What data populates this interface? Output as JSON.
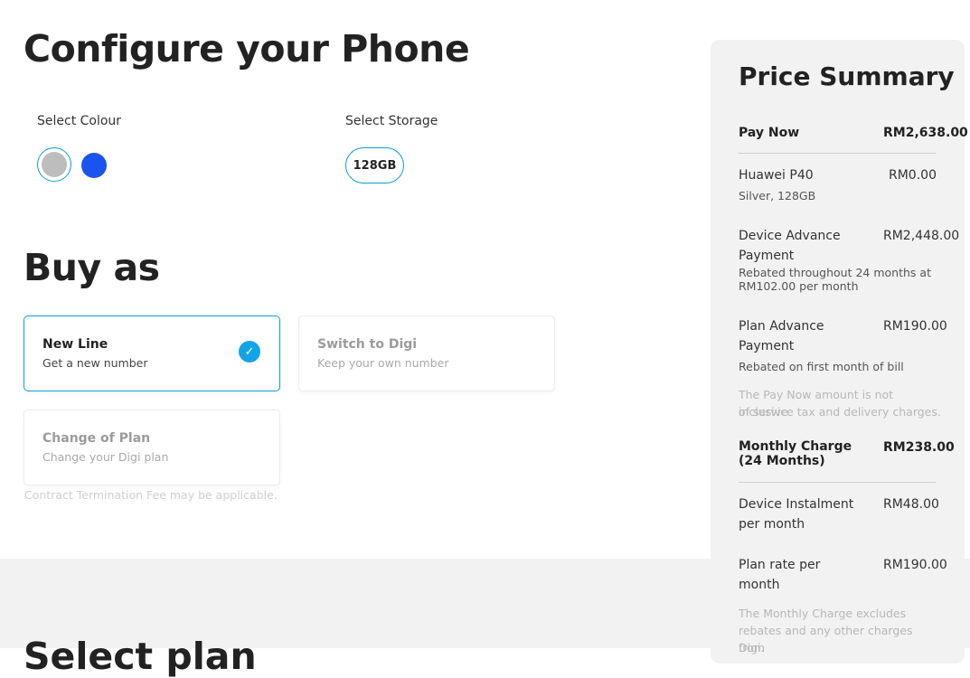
{
  "configure": {
    "title": "Configure your Phone",
    "colour_label": "Select Colour",
    "colours": [
      {
        "name": "Silver",
        "hex": "#bdbdbd",
        "selected": true
      },
      {
        "name": "Blue",
        "hex": "#1a54f0",
        "selected": false
      }
    ],
    "storage_label": "Select Storage",
    "storage_option": "128GB"
  },
  "buy_as": {
    "title": "Buy as",
    "options": [
      {
        "title": "New Line",
        "subtitle": "Get a new number",
        "selected": true
      },
      {
        "title": "Switch to Digi",
        "subtitle": "Keep your own number",
        "selected": false
      },
      {
        "title": "Change of Plan",
        "subtitle": "Change your Digi plan",
        "selected": false
      }
    ],
    "note": "Contract Termination Fee may be applicable."
  },
  "next_section_title": "Select plan",
  "summary": {
    "title": "Price Summary",
    "pay_now_label": "Pay Now",
    "pay_now_value": "RM2,638.00",
    "device_name": "Huawei P40",
    "device_value": "RM0.00",
    "device_variant": "Silver, 128GB",
    "device_advance_label_1": "Device Advance",
    "device_advance_label_2": "Payment",
    "device_advance_value": "RM2,448.00",
    "device_advance_note_1": "Rebated throughout 24 months at",
    "device_advance_note_2": "RM102.00 per month",
    "plan_advance_label_1": "Plan Advance",
    "plan_advance_label_2": "Payment",
    "plan_advance_value": "RM190.00",
    "plan_advance_note": "Rebated on first month of bill",
    "pay_now_disclaimer_1": "The Pay Now amount is not inclusive",
    "pay_now_disclaimer_2": "of service tax and delivery charges.",
    "monthly_label_1": "Monthly Charge",
    "monthly_label_2": "(24 Months)",
    "monthly_value": "RM238.00",
    "instalment_label_1": "Device Instalment",
    "instalment_label_2": "per month",
    "instalment_value": "RM48.00",
    "plan_rate_label_1": "Plan rate per",
    "plan_rate_label_2": "month",
    "plan_rate_value": "RM190.00",
    "monthly_disclaimer_1": "The Monthly Charge excludes",
    "monthly_disclaimer_2": "rebates and any other charges from",
    "monthly_disclaimer_3": "Digi."
  },
  "colors": {
    "accent": "#0aa0d8",
    "check": "#14a4e6",
    "panel_bg": "#f2f2f2"
  }
}
